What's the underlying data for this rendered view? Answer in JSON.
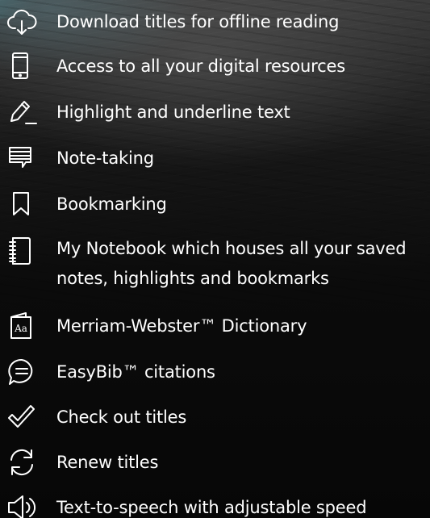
{
  "features": [
    {
      "icon": "cloud-download-icon",
      "label": "Download titles for offline reading"
    },
    {
      "icon": "mobile-device-icon",
      "label": "Access to all your digital resources"
    },
    {
      "icon": "highlighter-pen-icon",
      "label": "Highlight and underline text"
    },
    {
      "icon": "note-icon",
      "label": "Note-taking"
    },
    {
      "icon": "bookmark-icon",
      "label": "Bookmarking"
    },
    {
      "icon": "notebook-icon",
      "label": "My Notebook which houses all your saved notes, highlights and bookmarks"
    },
    {
      "icon": "dictionary-icon",
      "label": "Merriam-Webster™ Dictionary"
    },
    {
      "icon": "citation-speech-bubble-icon",
      "label": "EasyBib™ citations"
    },
    {
      "icon": "checkmark-icon",
      "label": "Check out titles"
    },
    {
      "icon": "renew-arrows-icon",
      "label": "Renew titles"
    },
    {
      "icon": "speaker-volume-icon",
      "label": "Text-to-speech with adjustable speed"
    }
  ]
}
